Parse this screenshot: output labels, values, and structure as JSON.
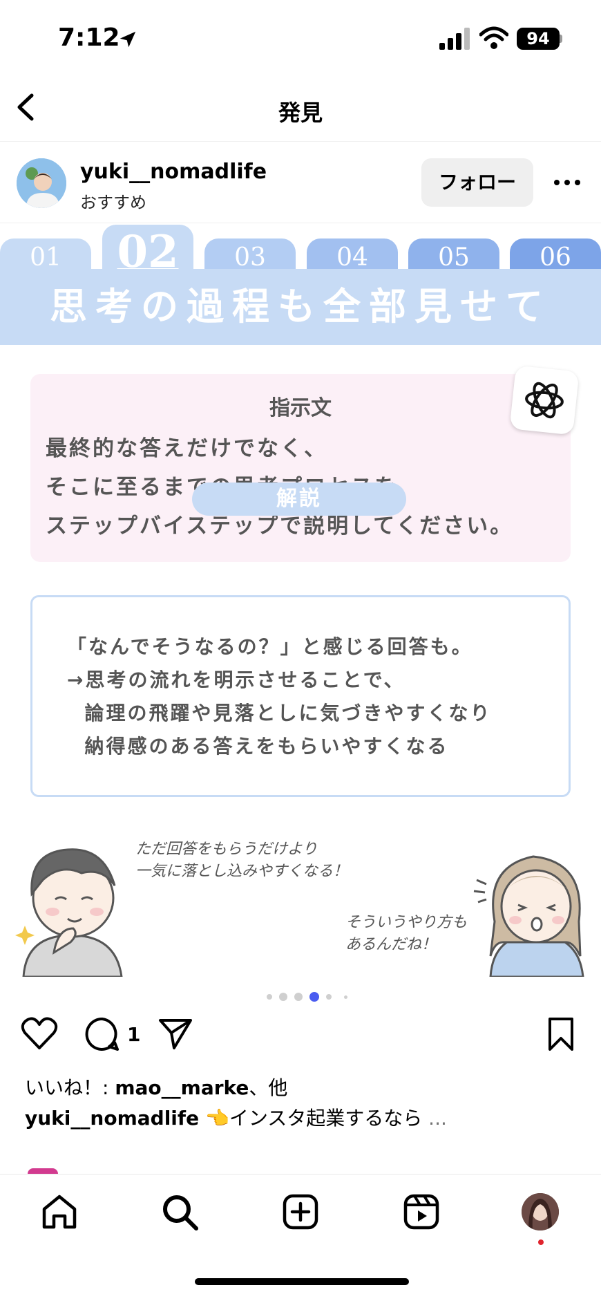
{
  "status_bar": {
    "time": "7:12",
    "battery": "94",
    "icons": [
      "location-arrow-icon",
      "signal-icon",
      "wifi-icon"
    ]
  },
  "nav": {
    "title": "発見",
    "back_icon": "chevron-left-icon"
  },
  "post": {
    "username": "yuki__nomadlife",
    "subtitle": "おすすめ",
    "follow_label": "フォロー",
    "more_icon": "ellipsis-icon",
    "image": {
      "tabs": [
        "01",
        "02",
        "03",
        "04",
        "05",
        "06"
      ],
      "active_tab": "02",
      "banner": "思考の過程も全部見せて",
      "instruction_title": "指示文",
      "instruction_lines": [
        "最終的な答えだけでなく、",
        "そこに至るまでの思考プロセスを",
        "ステップバイステップで説明してください。"
      ],
      "explanation_label": "解説",
      "explanation_lines": [
        "「なんでそうなるの？」と感じる回答も。",
        "→思考の流れを明示させることで、",
        "  論理の飛躍や見落としに気づきやすくなり",
        "  納得感のある答えをもらいやすくなる"
      ],
      "bubble_left": "ただ回答をもらうだけより\n一気に落とし込みやすくなる！",
      "bubble_right": "そういうやり方も\nあるんだね！"
    },
    "carousel": {
      "count": 6,
      "active_index": 3,
      "accent": "#4a5cf0"
    },
    "comment_count": "1",
    "likes_prefix": "いいね！: ",
    "likes_user": "mao__marke",
    "likes_suffix": "、他",
    "caption_user": "yuki__nomadlife",
    "caption_text": " 👈インスタ起業するなら",
    "caption_more": " ..."
  },
  "tab_bar": [
    "home-icon",
    "search-icon",
    "create-icon",
    "reels-icon",
    "profile-avatar"
  ]
}
